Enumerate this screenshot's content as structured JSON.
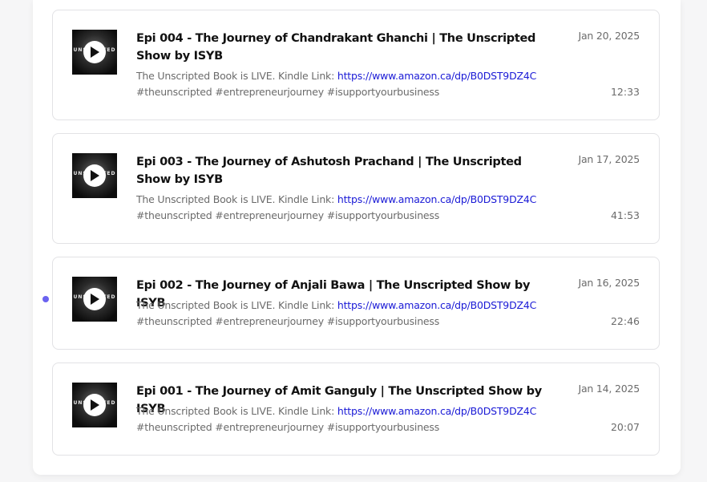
{
  "episodes": [
    {
      "title": "Epi 004 - The Journey of Chandrakant Ghanchi | The Unscripted Show by ISYB",
      "desc_prefix": "The Unscripted Book is LIVE. Kindle Link: ",
      "desc_link": "https://www.amazon.ca/dp/B0DST9DZ4C",
      "hashtags": "#theunscripted #entrepreneurjourney #isupportyourbusiness",
      "date": "Jan 20, 2025",
      "duration": "12:33",
      "thumb_text": "UNSCRIPTED",
      "playing": false
    },
    {
      "title": "Epi 003 - The Journey of Ashutosh Prachand | The Unscripted Show by ISYB",
      "desc_prefix": "The Unscripted Book is LIVE. Kindle Link: ",
      "desc_link": "https://www.amazon.ca/dp/B0DST9DZ4C",
      "hashtags": "#theunscripted #entrepreneurjourney #isupportyourbusiness",
      "date": "Jan 17, 2025",
      "duration": "41:53",
      "thumb_text": "UNSCRIPTED",
      "playing": false
    },
    {
      "title": "Epi 002 - The Journey of Anjali Bawa | The Unscripted Show by ISYB",
      "desc_prefix": "The Unscripted Book is LIVE. Kindle Link: ",
      "desc_link": "https://www.amazon.ca/dp/B0DST9DZ4C",
      "hashtags": "#theunscripted #entrepreneurjourney #isupportyourbusiness",
      "date": "Jan 16, 2025",
      "duration": "22:46",
      "thumb_text": "UNSCRIPTED",
      "playing": true
    },
    {
      "title": "Epi 001 - The Journey of Amit Ganguly | The Unscripted Show by ISYB",
      "desc_prefix": "The Unscripted Book is LIVE. Kindle Link: ",
      "desc_link": "https://www.amazon.ca/dp/B0DST9DZ4C",
      "hashtags": "#theunscripted #entrepreneurjourney #isupportyourbusiness",
      "date": "Jan 14, 2025",
      "duration": "20:07",
      "thumb_text": "UNSCRIPTED",
      "playing": false
    }
  ],
  "colors": {
    "accent_dot": "#6b63f0",
    "link": "#1a1ad6",
    "muted_text": "#6b6b6b",
    "border": "#e2e2e5"
  },
  "icons": {
    "play": "play-icon"
  }
}
